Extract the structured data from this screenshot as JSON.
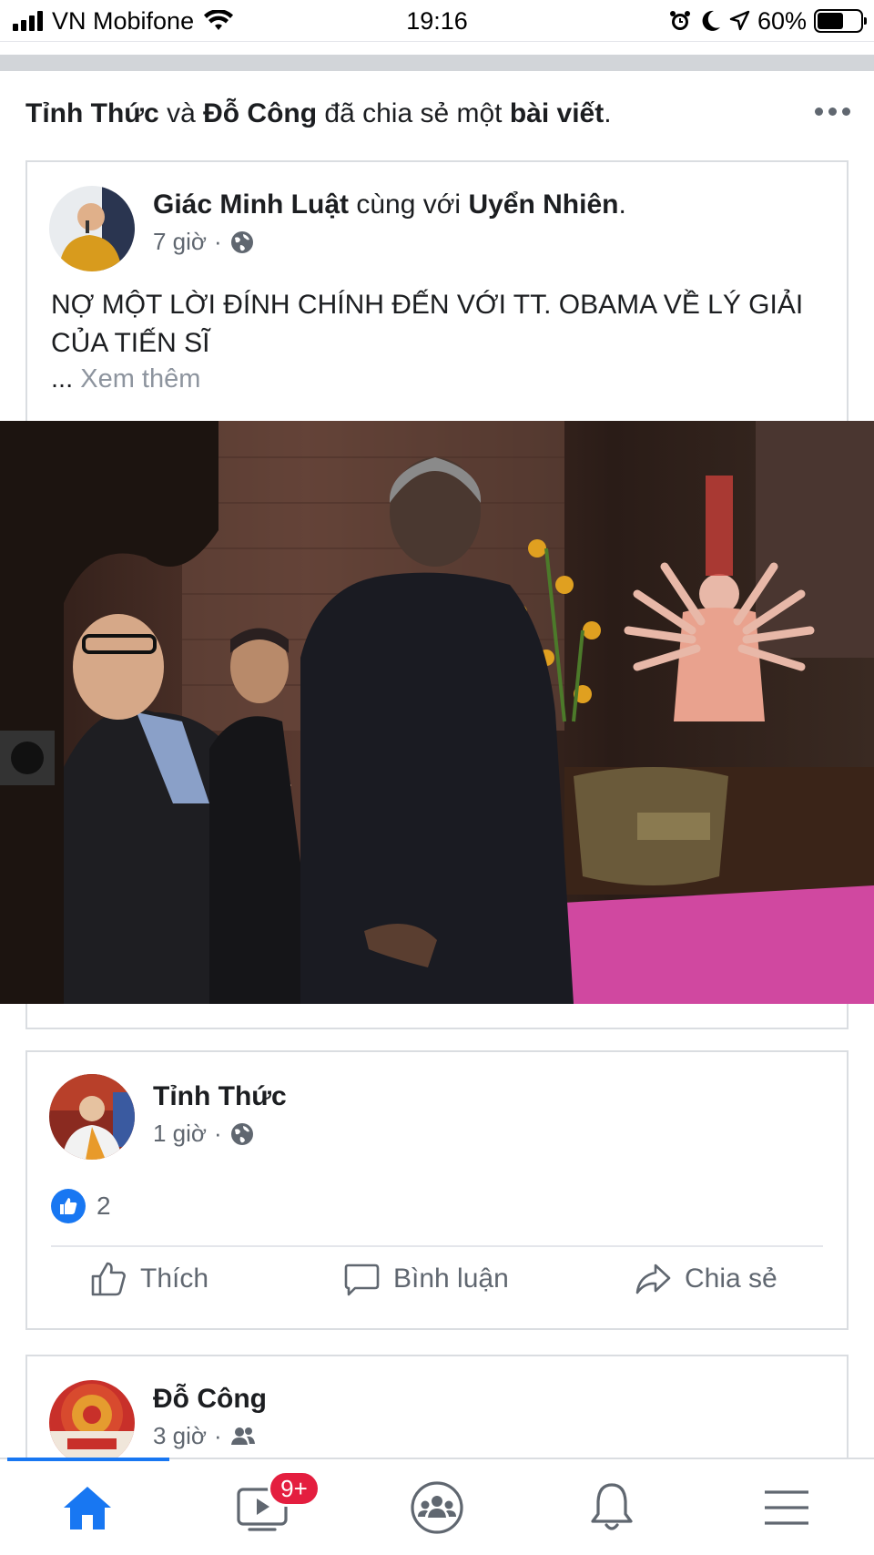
{
  "status_bar": {
    "carrier": "VN Mobifone",
    "time": "19:16",
    "battery": "60%",
    "battery_level": 0.6
  },
  "share_header": {
    "user1": "Tỉnh Thức",
    "conj": "và",
    "user2": "Đỗ Công",
    "action": "đã chia sẻ một",
    "object": "bài viết",
    "period": "."
  },
  "original_post": {
    "author": "Giác Minh Luật",
    "with_text": "cùng với",
    "tagged": "Uyển Nhiên",
    "period": ".",
    "time": "7 giờ",
    "dot": "·",
    "text": "NỢ MỘT LỜI ĐÍNH CHÍNH ĐẾN VỚI TT. OBAMA VỀ LÝ GIẢI CỦA TIẾN SĨ",
    "ellipsis": "...",
    "see_more": "Xem thêm"
  },
  "share_post_1": {
    "author": "Tỉnh Thức",
    "time": "1 giờ",
    "dot": "·",
    "likes_count": "2",
    "actions": {
      "like": "Thích",
      "comment": "Bình luận",
      "share": "Chia sẻ"
    }
  },
  "share_post_2": {
    "author": "Đỗ Công",
    "time": "3 giờ",
    "dot": "·"
  },
  "tab_bar": {
    "watch_badge": "9+",
    "icons": [
      "home-icon",
      "watch-icon",
      "groups-icon",
      "bell-icon",
      "menu-icon"
    ]
  },
  "colors": {
    "accent": "#1877f2",
    "badge": "#e41e3f",
    "text_secondary": "#606770"
  }
}
